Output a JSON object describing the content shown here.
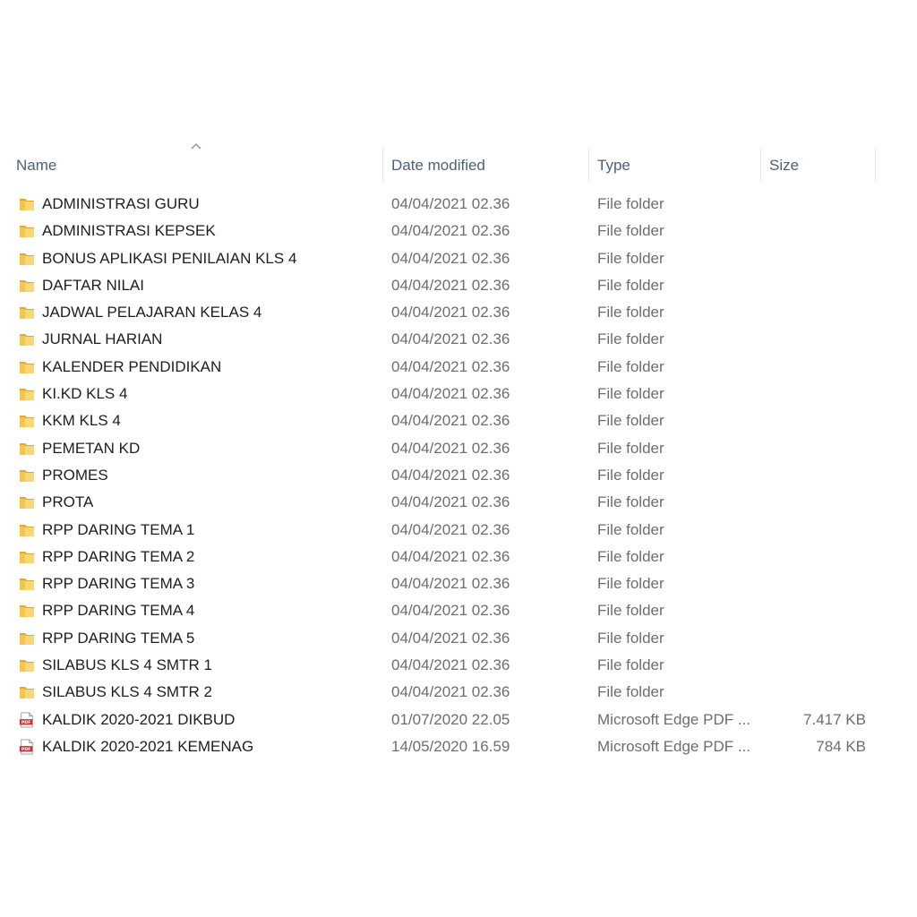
{
  "columns": {
    "name": "Name",
    "date": "Date modified",
    "type": "Type",
    "size": "Size"
  },
  "sort": {
    "column": "name",
    "direction": "ascending",
    "icon": "chevron-up-icon"
  },
  "files": [
    {
      "name": "ADMINISTRASI GURU",
      "date": "04/04/2021 02.36",
      "type": "File folder",
      "size": "",
      "icon": "folder-icon"
    },
    {
      "name": "ADMINISTRASI KEPSEK",
      "date": "04/04/2021 02.36",
      "type": "File folder",
      "size": "",
      "icon": "folder-icon"
    },
    {
      "name": "BONUS APLIKASI PENILAIAN KLS 4",
      "date": "04/04/2021 02.36",
      "type": "File folder",
      "size": "",
      "icon": "folder-icon"
    },
    {
      "name": "DAFTAR NILAI",
      "date": "04/04/2021 02.36",
      "type": "File folder",
      "size": "",
      "icon": "folder-icon"
    },
    {
      "name": "JADWAL PELAJARAN KELAS 4",
      "date": "04/04/2021 02.36",
      "type": "File folder",
      "size": "",
      "icon": "folder-icon"
    },
    {
      "name": "JURNAL HARIAN",
      "date": "04/04/2021 02.36",
      "type": "File folder",
      "size": "",
      "icon": "folder-icon"
    },
    {
      "name": "KALENDER PENDIDIKAN",
      "date": "04/04/2021 02.36",
      "type": "File folder",
      "size": "",
      "icon": "folder-icon"
    },
    {
      "name": "KI.KD KLS 4",
      "date": "04/04/2021 02.36",
      "type": "File folder",
      "size": "",
      "icon": "folder-icon"
    },
    {
      "name": "KKM KLS 4",
      "date": "04/04/2021 02.36",
      "type": "File folder",
      "size": "",
      "icon": "folder-icon"
    },
    {
      "name": "PEMETAN KD",
      "date": "04/04/2021 02.36",
      "type": "File folder",
      "size": "",
      "icon": "folder-icon"
    },
    {
      "name": "PROMES",
      "date": "04/04/2021 02.36",
      "type": "File folder",
      "size": "",
      "icon": "folder-icon"
    },
    {
      "name": "PROTA",
      "date": "04/04/2021 02.36",
      "type": "File folder",
      "size": "",
      "icon": "folder-icon"
    },
    {
      "name": "RPP DARING TEMA 1",
      "date": "04/04/2021 02.36",
      "type": "File folder",
      "size": "",
      "icon": "folder-icon"
    },
    {
      "name": "RPP DARING TEMA 2",
      "date": "04/04/2021 02.36",
      "type": "File folder",
      "size": "",
      "icon": "folder-icon"
    },
    {
      "name": "RPP DARING TEMA 3",
      "date": "04/04/2021 02.36",
      "type": "File folder",
      "size": "",
      "icon": "folder-icon"
    },
    {
      "name": "RPP DARING TEMA 4",
      "date": "04/04/2021 02.36",
      "type": "File folder",
      "size": "",
      "icon": "folder-icon"
    },
    {
      "name": "RPP DARING TEMA 5",
      "date": "04/04/2021 02.36",
      "type": "File folder",
      "size": "",
      "icon": "folder-icon"
    },
    {
      "name": "SILABUS KLS 4 SMTR 1",
      "date": "04/04/2021 02.36",
      "type": "File folder",
      "size": "",
      "icon": "folder-icon"
    },
    {
      "name": "SILABUS KLS 4 SMTR 2",
      "date": "04/04/2021 02.36",
      "type": "File folder",
      "size": "",
      "icon": "folder-icon"
    },
    {
      "name": "KALDIK 2020-2021 DIKBUD",
      "date": "01/07/2020 22.05",
      "type": "Microsoft Edge PDF ...",
      "size": "7.417 KB",
      "icon": "pdf-icon"
    },
    {
      "name": "KALDIK 2020-2021 KEMENAG",
      "date": "14/05/2020 16.59",
      "type": "Microsoft Edge PDF ...",
      "size": "784 KB",
      "icon": "pdf-icon"
    }
  ],
  "pdf_badge": "PDF",
  "colors": {
    "header_text": "#4c607a",
    "name_text": "#1e1e1e",
    "detail_text": "#6d6d6d",
    "folder_yellow": "#f8d775",
    "folder_dark": "#e0a82e",
    "pdf_red": "#d32f2f"
  }
}
